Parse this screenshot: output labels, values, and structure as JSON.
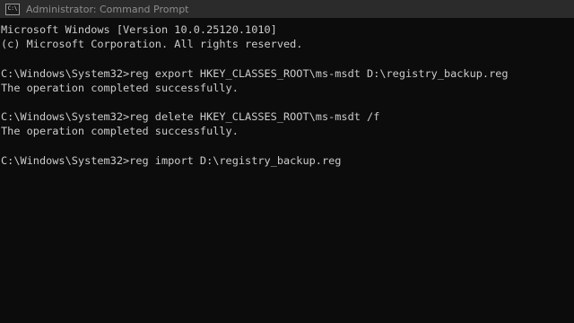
{
  "titlebar": {
    "icon_text": "C:\\",
    "title": "Administrator: Command Prompt"
  },
  "console": {
    "lines": [
      "Microsoft Windows [Version 10.0.25120.1010]",
      "(c) Microsoft Corporation. All rights reserved.",
      "",
      "C:\\Windows\\System32>reg export HKEY_CLASSES_ROOT\\ms-msdt D:\\registry_backup.reg",
      "The operation completed successfully.",
      "",
      "C:\\Windows\\System32>reg delete HKEY_CLASSES_ROOT\\ms-msdt /f",
      "The operation completed successfully.",
      "",
      "C:\\Windows\\System32>reg import D:\\registry_backup.reg"
    ]
  },
  "colors": {
    "background": "#0c0c0c",
    "titlebar": "#2b2b2b",
    "text": "#cccccc"
  }
}
